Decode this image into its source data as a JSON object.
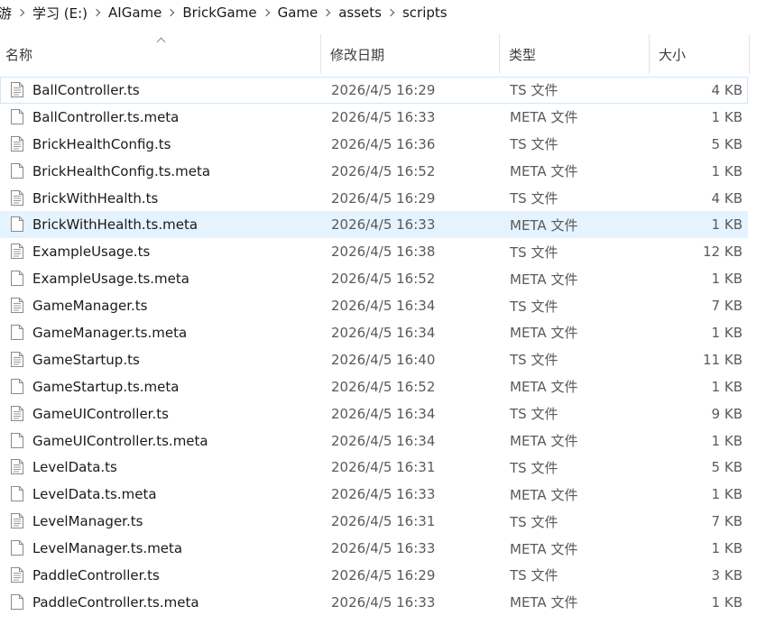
{
  "breadcrumb": {
    "items": [
      "游",
      "学习 (E:)",
      "AIGame",
      "BrickGame",
      "Game",
      "assets",
      "scripts"
    ]
  },
  "columns": {
    "name": "名称",
    "date": "修改日期",
    "type": "类型",
    "size": "大小"
  },
  "colors": {
    "hover_row": "#e5f3ff",
    "selected_outline": "#cfe7fb"
  },
  "files": [
    {
      "name": "BallController.ts",
      "date": "2026/4/5 16:29",
      "type": "TS 文件",
      "size": "4 KB",
      "icon": "text-file-icon"
    },
    {
      "name": "BallController.ts.meta",
      "date": "2026/4/5 16:33",
      "type": "META 文件",
      "size": "1 KB",
      "icon": "blank-file-icon"
    },
    {
      "name": "BrickHealthConfig.ts",
      "date": "2026/4/5 16:36",
      "type": "TS 文件",
      "size": "5 KB",
      "icon": "text-file-icon"
    },
    {
      "name": "BrickHealthConfig.ts.meta",
      "date": "2026/4/5 16:52",
      "type": "META 文件",
      "size": "1 KB",
      "icon": "blank-file-icon"
    },
    {
      "name": "BrickWithHealth.ts",
      "date": "2026/4/5 16:29",
      "type": "TS 文件",
      "size": "4 KB",
      "icon": "text-file-icon"
    },
    {
      "name": "BrickWithHealth.ts.meta",
      "date": "2026/4/5 16:33",
      "type": "META 文件",
      "size": "1 KB",
      "icon": "blank-file-icon"
    },
    {
      "name": "ExampleUsage.ts",
      "date": "2026/4/5 16:38",
      "type": "TS 文件",
      "size": "12 KB",
      "icon": "text-file-icon"
    },
    {
      "name": "ExampleUsage.ts.meta",
      "date": "2026/4/5 16:52",
      "type": "META 文件",
      "size": "1 KB",
      "icon": "blank-file-icon"
    },
    {
      "name": "GameManager.ts",
      "date": "2026/4/5 16:34",
      "type": "TS 文件",
      "size": "7 KB",
      "icon": "text-file-icon"
    },
    {
      "name": "GameManager.ts.meta",
      "date": "2026/4/5 16:34",
      "type": "META 文件",
      "size": "1 KB",
      "icon": "blank-file-icon"
    },
    {
      "name": "GameStartup.ts",
      "date": "2026/4/5 16:40",
      "type": "TS 文件",
      "size": "11 KB",
      "icon": "text-file-icon"
    },
    {
      "name": "GameStartup.ts.meta",
      "date": "2026/4/5 16:52",
      "type": "META 文件",
      "size": "1 KB",
      "icon": "blank-file-icon"
    },
    {
      "name": "GameUIController.ts",
      "date": "2026/4/5 16:34",
      "type": "TS 文件",
      "size": "9 KB",
      "icon": "text-file-icon"
    },
    {
      "name": "GameUIController.ts.meta",
      "date": "2026/4/5 16:34",
      "type": "META 文件",
      "size": "1 KB",
      "icon": "blank-file-icon"
    },
    {
      "name": "LevelData.ts",
      "date": "2026/4/5 16:31",
      "type": "TS 文件",
      "size": "5 KB",
      "icon": "text-file-icon"
    },
    {
      "name": "LevelData.ts.meta",
      "date": "2026/4/5 16:33",
      "type": "META 文件",
      "size": "1 KB",
      "icon": "blank-file-icon"
    },
    {
      "name": "LevelManager.ts",
      "date": "2026/4/5 16:31",
      "type": "TS 文件",
      "size": "7 KB",
      "icon": "text-file-icon"
    },
    {
      "name": "LevelManager.ts.meta",
      "date": "2026/4/5 16:33",
      "type": "META 文件",
      "size": "1 KB",
      "icon": "blank-file-icon"
    },
    {
      "name": "PaddleController.ts",
      "date": "2026/4/5 16:29",
      "type": "TS 文件",
      "size": "3 KB",
      "icon": "text-file-icon"
    },
    {
      "name": "PaddleController.ts.meta",
      "date": "2026/4/5 16:33",
      "type": "META 文件",
      "size": "1 KB",
      "icon": "blank-file-icon"
    }
  ]
}
